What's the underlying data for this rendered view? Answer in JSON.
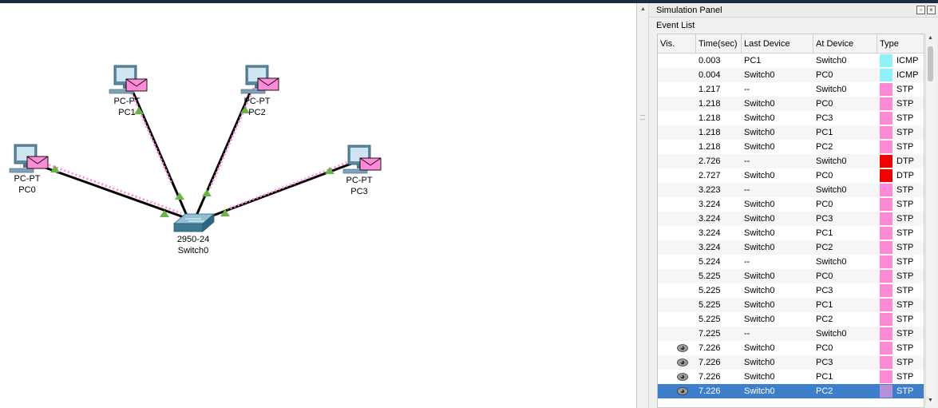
{
  "workspace": {
    "devices": [
      {
        "id": "pc0",
        "model": "PC-PT",
        "name": "PC0"
      },
      {
        "id": "pc1",
        "model": "PC-PT",
        "name": "PC1"
      },
      {
        "id": "pc2",
        "model": "PC-PT",
        "name": "PC2"
      },
      {
        "id": "pc3",
        "model": "PC-PT",
        "name": "PC3"
      },
      {
        "id": "switch0",
        "model": "2950-24",
        "name": "Switch0"
      }
    ]
  },
  "panel": {
    "title": "Simulation Panel",
    "restore_icon": "restore-icon",
    "close_icon": "close-icon",
    "event_list_label": "Event List",
    "columns": [
      "Vis.",
      "Time(sec)",
      "Last Device",
      "At Device",
      "Type"
    ],
    "type_colors": {
      "ICMP": "#8ff0f7",
      "STP": "#ff8bd8",
      "DTP": "#f20000",
      "STP_selected": "#b98fdc"
    },
    "events": [
      {
        "vis": "",
        "time": "0.003",
        "last": "PC1",
        "at": "Switch0",
        "type": "ICMP"
      },
      {
        "vis": "",
        "time": "0.004",
        "last": "Switch0",
        "at": "PC0",
        "type": "ICMP"
      },
      {
        "vis": "",
        "time": "1.217",
        "last": "--",
        "at": "Switch0",
        "type": "STP"
      },
      {
        "vis": "",
        "time": "1.218",
        "last": "Switch0",
        "at": "PC0",
        "type": "STP"
      },
      {
        "vis": "",
        "time": "1.218",
        "last": "Switch0",
        "at": "PC3",
        "type": "STP"
      },
      {
        "vis": "",
        "time": "1.218",
        "last": "Switch0",
        "at": "PC1",
        "type": "STP"
      },
      {
        "vis": "",
        "time": "1.218",
        "last": "Switch0",
        "at": "PC2",
        "type": "STP"
      },
      {
        "vis": "",
        "time": "2.726",
        "last": "--",
        "at": "Switch0",
        "type": "DTP"
      },
      {
        "vis": "",
        "time": "2.727",
        "last": "Switch0",
        "at": "PC0",
        "type": "DTP"
      },
      {
        "vis": "",
        "time": "3.223",
        "last": "--",
        "at": "Switch0",
        "type": "STP"
      },
      {
        "vis": "",
        "time": "3.224",
        "last": "Switch0",
        "at": "PC0",
        "type": "STP"
      },
      {
        "vis": "",
        "time": "3.224",
        "last": "Switch0",
        "at": "PC3",
        "type": "STP"
      },
      {
        "vis": "",
        "time": "3.224",
        "last": "Switch0",
        "at": "PC1",
        "type": "STP"
      },
      {
        "vis": "",
        "time": "3.224",
        "last": "Switch0",
        "at": "PC2",
        "type": "STP"
      },
      {
        "vis": "",
        "time": "5.224",
        "last": "--",
        "at": "Switch0",
        "type": "STP"
      },
      {
        "vis": "",
        "time": "5.225",
        "last": "Switch0",
        "at": "PC0",
        "type": "STP"
      },
      {
        "vis": "",
        "time": "5.225",
        "last": "Switch0",
        "at": "PC3",
        "type": "STP"
      },
      {
        "vis": "",
        "time": "5.225",
        "last": "Switch0",
        "at": "PC1",
        "type": "STP"
      },
      {
        "vis": "",
        "time": "5.225",
        "last": "Switch0",
        "at": "PC2",
        "type": "STP"
      },
      {
        "vis": "",
        "time": "7.225",
        "last": "--",
        "at": "Switch0",
        "type": "STP"
      },
      {
        "vis": "eye-icon",
        "time": "7.226",
        "last": "Switch0",
        "at": "PC0",
        "type": "STP"
      },
      {
        "vis": "eye-icon",
        "time": "7.226",
        "last": "Switch0",
        "at": "PC3",
        "type": "STP"
      },
      {
        "vis": "eye-icon",
        "time": "7.226",
        "last": "Switch0",
        "at": "PC1",
        "type": "STP"
      },
      {
        "vis": "eye-icon",
        "time": "7.226",
        "last": "Switch0",
        "at": "PC2",
        "type": "STP",
        "selected": true
      }
    ]
  }
}
